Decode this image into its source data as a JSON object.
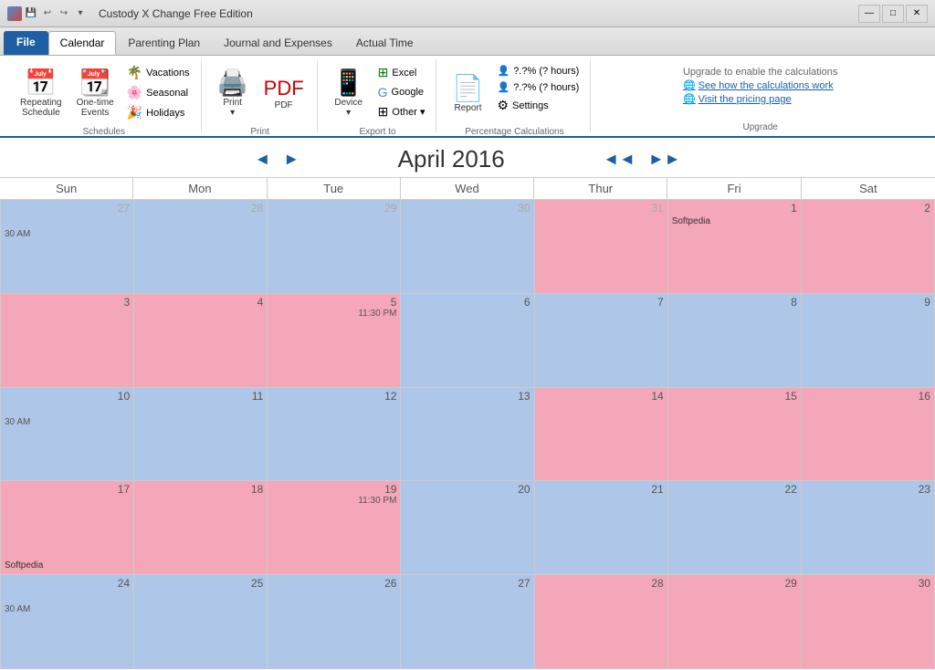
{
  "titleBar": {
    "title": "Custody X Change Free Edition",
    "minBtn": "—",
    "maxBtn": "□",
    "closeBtn": "✕"
  },
  "tabs": [
    {
      "id": "file",
      "label": "File",
      "active": false
    },
    {
      "id": "calendar",
      "label": "Calendar",
      "active": true
    },
    {
      "id": "parenting",
      "label": "Parenting Plan",
      "active": false
    },
    {
      "id": "journal",
      "label": "Journal and Expenses",
      "active": false
    },
    {
      "id": "actual",
      "label": "Actual Time",
      "active": false
    }
  ],
  "ribbon": {
    "schedules": {
      "label": "Schedules",
      "repeating": "Repeating\nSchedule",
      "oneTime": "One-time\nEvents",
      "vacations": "Vacations",
      "seasonal": "Seasonal",
      "holidays": "Holidays"
    },
    "print": {
      "label": "Print",
      "print": "Print",
      "pdf": "PDF"
    },
    "exportTo": {
      "label": "Export to",
      "device": "Device",
      "excel": "Excel",
      "google": "Google",
      "other": "Other ▾"
    },
    "report": {
      "label": "",
      "report": "Report",
      "percentCalc": "Percentage Calculations",
      "percent1": "?.?% (? hours)",
      "percent2": "?.?% (? hours)",
      "settings": "Settings"
    },
    "upgrade": {
      "label": "Upgrade",
      "title": "Upgrade to enable the calculations",
      "calcLink": "See how the calculations work",
      "pricingLink": "Visit the pricing page"
    }
  },
  "calendar": {
    "title": "April 2016",
    "prevMonth": "◄",
    "nextMonth": "►",
    "prevYear": "◄◄",
    "nextYear": "►►",
    "dayHeaders": [
      "Sun",
      "Mon",
      "Tue",
      "Wed",
      "Thur",
      "Fri",
      "Sat"
    ],
    "weeks": [
      [
        {
          "num": "27",
          "outside": true,
          "color": "blue",
          "texts": [],
          "ampm": "30 AM"
        },
        {
          "num": "28",
          "outside": true,
          "color": "blue",
          "texts": []
        },
        {
          "num": "29",
          "outside": true,
          "color": "blue",
          "texts": []
        },
        {
          "num": "30",
          "outside": true,
          "color": "blue",
          "texts": []
        },
        {
          "num": "31",
          "outside": true,
          "color": "pink",
          "texts": []
        },
        {
          "num": "1",
          "outside": false,
          "color": "pink",
          "texts": [
            "Softpedia"
          ]
        },
        {
          "num": "2",
          "outside": false,
          "color": "pink",
          "texts": []
        }
      ],
      [
        {
          "num": "3",
          "outside": false,
          "color": "pink",
          "texts": []
        },
        {
          "num": "4",
          "outside": false,
          "color": "pink",
          "texts": []
        },
        {
          "num": "5",
          "outside": false,
          "color": "pink",
          "texts": [],
          "time": "11:30 PM"
        },
        {
          "num": "6",
          "outside": false,
          "color": "blue",
          "texts": []
        },
        {
          "num": "7",
          "outside": false,
          "color": "blue",
          "texts": []
        },
        {
          "num": "8",
          "outside": false,
          "color": "blue",
          "texts": []
        },
        {
          "num": "9",
          "outside": false,
          "color": "blue",
          "texts": []
        }
      ],
      [
        {
          "num": "10",
          "outside": false,
          "color": "blue",
          "texts": [],
          "ampm": "30 AM"
        },
        {
          "num": "11",
          "outside": false,
          "color": "blue",
          "texts": []
        },
        {
          "num": "12",
          "outside": false,
          "color": "blue",
          "texts": []
        },
        {
          "num": "13",
          "outside": false,
          "color": "blue",
          "texts": []
        },
        {
          "num": "14",
          "outside": false,
          "color": "pink",
          "texts": []
        },
        {
          "num": "15",
          "outside": false,
          "color": "pink",
          "texts": []
        },
        {
          "num": "16",
          "outside": false,
          "color": "pink",
          "texts": []
        }
      ],
      [
        {
          "num": "17",
          "outside": false,
          "color": "pink",
          "texts": [],
          "label": "Softpedia"
        },
        {
          "num": "18",
          "outside": false,
          "color": "pink",
          "texts": []
        },
        {
          "num": "19",
          "outside": false,
          "color": "pink",
          "texts": [],
          "time": "11:30 PM"
        },
        {
          "num": "20",
          "outside": false,
          "color": "blue",
          "texts": []
        },
        {
          "num": "21",
          "outside": false,
          "color": "blue",
          "texts": []
        },
        {
          "num": "22",
          "outside": false,
          "color": "blue",
          "texts": []
        },
        {
          "num": "23",
          "outside": false,
          "color": "blue",
          "texts": []
        }
      ],
      [
        {
          "num": "24",
          "outside": false,
          "color": "blue",
          "texts": [],
          "ampm": "30 AM"
        },
        {
          "num": "25",
          "outside": false,
          "color": "blue",
          "texts": []
        },
        {
          "num": "26",
          "outside": false,
          "color": "blue",
          "texts": []
        },
        {
          "num": "27",
          "outside": false,
          "color": "blue",
          "texts": []
        },
        {
          "num": "28",
          "outside": false,
          "color": "pink",
          "texts": []
        },
        {
          "num": "29",
          "outside": false,
          "color": "pink",
          "texts": []
        },
        {
          "num": "30",
          "outside": false,
          "color": "pink",
          "texts": []
        }
      ]
    ]
  }
}
